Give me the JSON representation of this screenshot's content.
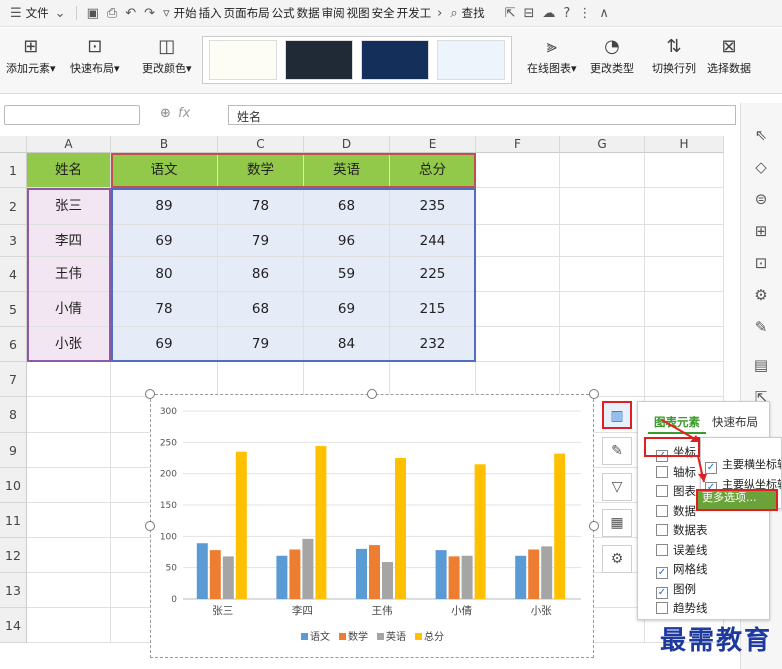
{
  "menubar": {
    "file": "文件",
    "tabs": [
      "开始",
      "插入",
      "页面布局",
      "公式",
      "数据",
      "审阅",
      "视图",
      "安全",
      "开发工"
    ],
    "search": "查找"
  },
  "ribbon": {
    "add_element": "添加元素",
    "quick_layout": "快速布局",
    "change_color": "更改颜色",
    "online_chart": "在线图表",
    "change_type": "更改类型",
    "switch_row_col": "切换行列",
    "select_data": "选择数据"
  },
  "formula": {
    "fx": "fx",
    "content": "姓名"
  },
  "columns": [
    "A",
    "B",
    "C",
    "D",
    "E",
    "F",
    "G",
    "H"
  ],
  "rows": [
    "1",
    "2",
    "3",
    "4",
    "5",
    "6",
    "7",
    "8",
    "9",
    "10",
    "11",
    "12",
    "13",
    "14"
  ],
  "table": {
    "header": [
      "姓名",
      "语文",
      "数学",
      "英语",
      "总分"
    ],
    "data": [
      [
        "张三",
        "89",
        "78",
        "68",
        "235"
      ],
      [
        "李四",
        "69",
        "79",
        "96",
        "244"
      ],
      [
        "王伟",
        "80",
        "86",
        "59",
        "225"
      ],
      [
        "小倩",
        "78",
        "68",
        "69",
        "215"
      ],
      [
        "小张",
        "69",
        "79",
        "84",
        "232"
      ]
    ]
  },
  "chart_data": {
    "type": "bar",
    "categories": [
      "张三",
      "李四",
      "王伟",
      "小倩",
      "小张"
    ],
    "series": [
      {
        "name": "语文",
        "values": [
          89,
          69,
          80,
          78,
          69
        ],
        "color": "#5b9bd5"
      },
      {
        "name": "数学",
        "values": [
          78,
          79,
          86,
          68,
          79
        ],
        "color": "#ed7d31"
      },
      {
        "name": "英语",
        "values": [
          68,
          96,
          59,
          69,
          84
        ],
        "color": "#a5a5a5"
      },
      {
        "name": "总分",
        "values": [
          235,
          244,
          225,
          215,
          232
        ],
        "color": "#ffc000"
      }
    ],
    "ylim": [
      0,
      300
    ],
    "yticks": [
      "0",
      "50",
      "100",
      "150",
      "200",
      "250",
      "300"
    ],
    "legend": "bottom",
    "grid": true
  },
  "panel": {
    "tab1": "图表元素",
    "tab2": "快速布局",
    "items": [
      {
        "label": "坐标",
        "checked": true
      },
      {
        "label": "轴标",
        "checked": false
      },
      {
        "label": "图表",
        "checked": false
      },
      {
        "label": "数据",
        "checked": false
      },
      {
        "label": "数据表",
        "checked": false
      },
      {
        "label": "误差线",
        "checked": false
      },
      {
        "label": "网格线",
        "checked": true
      },
      {
        "label": "图例",
        "checked": true
      },
      {
        "label": "趋势线",
        "checked": false
      }
    ]
  },
  "subpanel": {
    "items": [
      {
        "label": "主要横坐标轴",
        "checked": true
      },
      {
        "label": "主要纵坐标轴",
        "checked": true
      }
    ],
    "more": "更多选项..."
  },
  "watermark": "最需教育"
}
